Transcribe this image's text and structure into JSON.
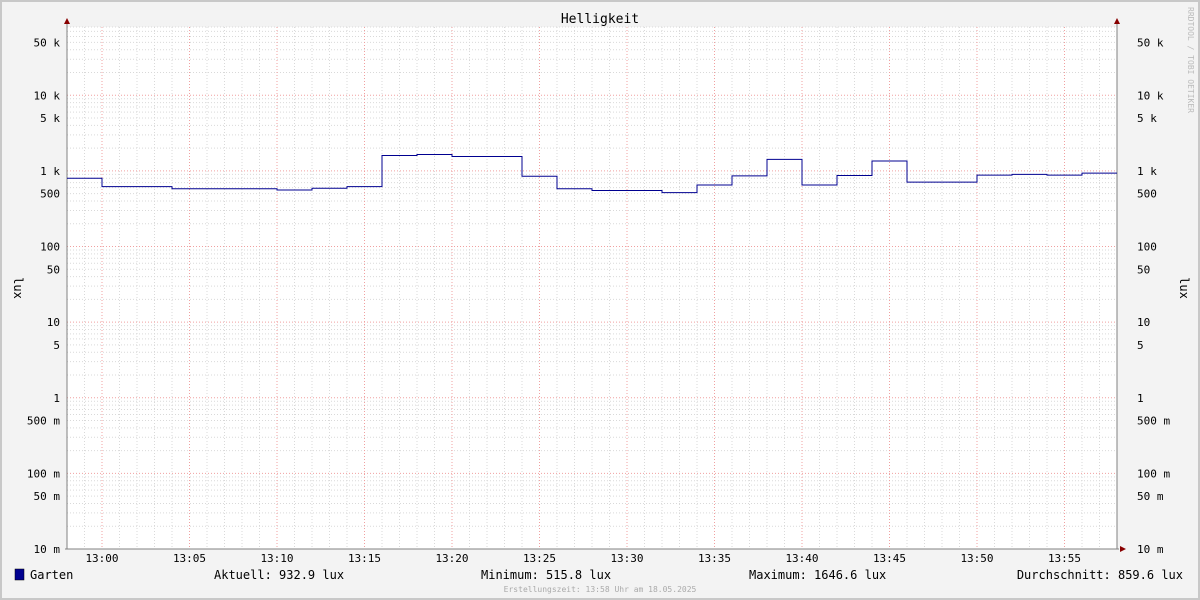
{
  "chart_data": {
    "type": "line",
    "title": "Helligkeit",
    "ylabel": "lux",
    "yscale": "log",
    "ylim": [
      0.01,
      80000
    ],
    "xlim": [
      "12:58",
      "13:58"
    ],
    "x_ticks": [
      "13:00",
      "13:05",
      "13:10",
      "13:15",
      "13:20",
      "13:25",
      "13:30",
      "13:35",
      "13:40",
      "13:45",
      "13:50",
      "13:55"
    ],
    "y_ticks": [
      {
        "value": 50000,
        "label": "50 k"
      },
      {
        "value": 10000,
        "label": "10 k"
      },
      {
        "value": 5000,
        "label": "5 k"
      },
      {
        "value": 1000,
        "label": "1 k"
      },
      {
        "value": 500,
        "label": "500"
      },
      {
        "value": 100,
        "label": "100"
      },
      {
        "value": 50,
        "label": "50"
      },
      {
        "value": 10,
        "label": "10"
      },
      {
        "value": 5,
        "label": "5"
      },
      {
        "value": 1,
        "label": "1"
      },
      {
        "value": 0.5,
        "label": "500 m"
      },
      {
        "value": 0.1,
        "label": "100 m"
      },
      {
        "value": 0.05,
        "label": "50 m"
      },
      {
        "value": 0.01,
        "label": "10 m"
      }
    ],
    "series": [
      {
        "name": "Garten",
        "color": "#000090",
        "x": [
          "12:58",
          "13:00",
          "13:02",
          "13:04",
          "13:06",
          "13:08",
          "13:10",
          "13:12",
          "13:14",
          "13:16",
          "13:18",
          "13:20",
          "13:22",
          "13:24",
          "13:26",
          "13:28",
          "13:30",
          "13:32",
          "13:34",
          "13:36",
          "13:38",
          "13:40",
          "13:42",
          "13:44",
          "13:46",
          "13:48",
          "13:50",
          "13:52",
          "13:54",
          "13:56"
        ],
        "y": [
          800,
          620,
          620,
          580,
          580,
          580,
          560,
          590,
          620,
          1600,
          1650,
          1550,
          1550,
          850,
          580,
          550,
          550,
          516,
          650,
          860,
          1420,
          650,
          870,
          1350,
          710,
          710,
          880,
          900,
          880,
          933
        ]
      }
    ],
    "grid": true,
    "legend": {
      "position": "bottom-left"
    }
  },
  "stats": {
    "current": "Aktuell: 932.9 lux",
    "minimum": "Minimum: 515.8 lux",
    "maximum": "Maximum: 1646.6 lux",
    "average": "Durchschnitt: 859.6 lux"
  },
  "footer": "Erstellungszeit: 13:58 Uhr am 18.05.2025",
  "watermark": "RRDTOOL / TOBI OETIKER",
  "colors": {
    "background": "#f3f3f3",
    "plot": "#ffffff",
    "minor_grid": "#d9d9d9",
    "major_grid": "#f0a0a0",
    "axis": "#808080",
    "arrow": "#880000"
  }
}
